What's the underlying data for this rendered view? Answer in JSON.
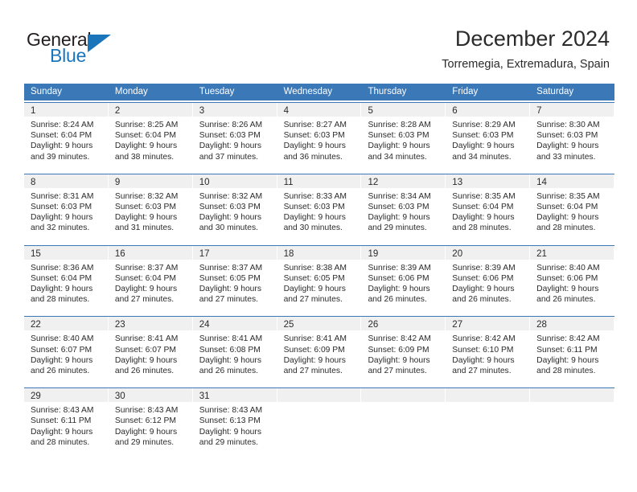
{
  "brand": {
    "general": "General",
    "blue": "Blue",
    "triangle_icon": "triangle-right-icon",
    "accent_color": "#1b75bb"
  },
  "header": {
    "title": "December 2024",
    "subtitle": "Torremegia, Extremadura, Spain"
  },
  "calendar": {
    "header_color": "#3b78b8",
    "daynum_band_color": "#f0f0f0",
    "weekdays": [
      "Sunday",
      "Monday",
      "Tuesday",
      "Wednesday",
      "Thursday",
      "Friday",
      "Saturday"
    ],
    "weeks": [
      [
        {
          "day": "1",
          "sunrise": "Sunrise: 8:24 AM",
          "sunset": "Sunset: 6:04 PM",
          "daylight1": "Daylight: 9 hours",
          "daylight2": "and 39 minutes."
        },
        {
          "day": "2",
          "sunrise": "Sunrise: 8:25 AM",
          "sunset": "Sunset: 6:04 PM",
          "daylight1": "Daylight: 9 hours",
          "daylight2": "and 38 minutes."
        },
        {
          "day": "3",
          "sunrise": "Sunrise: 8:26 AM",
          "sunset": "Sunset: 6:03 PM",
          "daylight1": "Daylight: 9 hours",
          "daylight2": "and 37 minutes."
        },
        {
          "day": "4",
          "sunrise": "Sunrise: 8:27 AM",
          "sunset": "Sunset: 6:03 PM",
          "daylight1": "Daylight: 9 hours",
          "daylight2": "and 36 minutes."
        },
        {
          "day": "5",
          "sunrise": "Sunrise: 8:28 AM",
          "sunset": "Sunset: 6:03 PM",
          "daylight1": "Daylight: 9 hours",
          "daylight2": "and 34 minutes."
        },
        {
          "day": "6",
          "sunrise": "Sunrise: 8:29 AM",
          "sunset": "Sunset: 6:03 PM",
          "daylight1": "Daylight: 9 hours",
          "daylight2": "and 34 minutes."
        },
        {
          "day": "7",
          "sunrise": "Sunrise: 8:30 AM",
          "sunset": "Sunset: 6:03 PM",
          "daylight1": "Daylight: 9 hours",
          "daylight2": "and 33 minutes."
        }
      ],
      [
        {
          "day": "8",
          "sunrise": "Sunrise: 8:31 AM",
          "sunset": "Sunset: 6:03 PM",
          "daylight1": "Daylight: 9 hours",
          "daylight2": "and 32 minutes."
        },
        {
          "day": "9",
          "sunrise": "Sunrise: 8:32 AM",
          "sunset": "Sunset: 6:03 PM",
          "daylight1": "Daylight: 9 hours",
          "daylight2": "and 31 minutes."
        },
        {
          "day": "10",
          "sunrise": "Sunrise: 8:32 AM",
          "sunset": "Sunset: 6:03 PM",
          "daylight1": "Daylight: 9 hours",
          "daylight2": "and 30 minutes."
        },
        {
          "day": "11",
          "sunrise": "Sunrise: 8:33 AM",
          "sunset": "Sunset: 6:03 PM",
          "daylight1": "Daylight: 9 hours",
          "daylight2": "and 30 minutes."
        },
        {
          "day": "12",
          "sunrise": "Sunrise: 8:34 AM",
          "sunset": "Sunset: 6:03 PM",
          "daylight1": "Daylight: 9 hours",
          "daylight2": "and 29 minutes."
        },
        {
          "day": "13",
          "sunrise": "Sunrise: 8:35 AM",
          "sunset": "Sunset: 6:04 PM",
          "daylight1": "Daylight: 9 hours",
          "daylight2": "and 28 minutes."
        },
        {
          "day": "14",
          "sunrise": "Sunrise: 8:35 AM",
          "sunset": "Sunset: 6:04 PM",
          "daylight1": "Daylight: 9 hours",
          "daylight2": "and 28 minutes."
        }
      ],
      [
        {
          "day": "15",
          "sunrise": "Sunrise: 8:36 AM",
          "sunset": "Sunset: 6:04 PM",
          "daylight1": "Daylight: 9 hours",
          "daylight2": "and 28 minutes."
        },
        {
          "day": "16",
          "sunrise": "Sunrise: 8:37 AM",
          "sunset": "Sunset: 6:04 PM",
          "daylight1": "Daylight: 9 hours",
          "daylight2": "and 27 minutes."
        },
        {
          "day": "17",
          "sunrise": "Sunrise: 8:37 AM",
          "sunset": "Sunset: 6:05 PM",
          "daylight1": "Daylight: 9 hours",
          "daylight2": "and 27 minutes."
        },
        {
          "day": "18",
          "sunrise": "Sunrise: 8:38 AM",
          "sunset": "Sunset: 6:05 PM",
          "daylight1": "Daylight: 9 hours",
          "daylight2": "and 27 minutes."
        },
        {
          "day": "19",
          "sunrise": "Sunrise: 8:39 AM",
          "sunset": "Sunset: 6:06 PM",
          "daylight1": "Daylight: 9 hours",
          "daylight2": "and 26 minutes."
        },
        {
          "day": "20",
          "sunrise": "Sunrise: 8:39 AM",
          "sunset": "Sunset: 6:06 PM",
          "daylight1": "Daylight: 9 hours",
          "daylight2": "and 26 minutes."
        },
        {
          "day": "21",
          "sunrise": "Sunrise: 8:40 AM",
          "sunset": "Sunset: 6:06 PM",
          "daylight1": "Daylight: 9 hours",
          "daylight2": "and 26 minutes."
        }
      ],
      [
        {
          "day": "22",
          "sunrise": "Sunrise: 8:40 AM",
          "sunset": "Sunset: 6:07 PM",
          "daylight1": "Daylight: 9 hours",
          "daylight2": "and 26 minutes."
        },
        {
          "day": "23",
          "sunrise": "Sunrise: 8:41 AM",
          "sunset": "Sunset: 6:07 PM",
          "daylight1": "Daylight: 9 hours",
          "daylight2": "and 26 minutes."
        },
        {
          "day": "24",
          "sunrise": "Sunrise: 8:41 AM",
          "sunset": "Sunset: 6:08 PM",
          "daylight1": "Daylight: 9 hours",
          "daylight2": "and 26 minutes."
        },
        {
          "day": "25",
          "sunrise": "Sunrise: 8:41 AM",
          "sunset": "Sunset: 6:09 PM",
          "daylight1": "Daylight: 9 hours",
          "daylight2": "and 27 minutes."
        },
        {
          "day": "26",
          "sunrise": "Sunrise: 8:42 AM",
          "sunset": "Sunset: 6:09 PM",
          "daylight1": "Daylight: 9 hours",
          "daylight2": "and 27 minutes."
        },
        {
          "day": "27",
          "sunrise": "Sunrise: 8:42 AM",
          "sunset": "Sunset: 6:10 PM",
          "daylight1": "Daylight: 9 hours",
          "daylight2": "and 27 minutes."
        },
        {
          "day": "28",
          "sunrise": "Sunrise: 8:42 AM",
          "sunset": "Sunset: 6:11 PM",
          "daylight1": "Daylight: 9 hours",
          "daylight2": "and 28 minutes."
        }
      ],
      [
        {
          "day": "29",
          "sunrise": "Sunrise: 8:43 AM",
          "sunset": "Sunset: 6:11 PM",
          "daylight1": "Daylight: 9 hours",
          "daylight2": "and 28 minutes."
        },
        {
          "day": "30",
          "sunrise": "Sunrise: 8:43 AM",
          "sunset": "Sunset: 6:12 PM",
          "daylight1": "Daylight: 9 hours",
          "daylight2": "and 29 minutes."
        },
        {
          "day": "31",
          "sunrise": "Sunrise: 8:43 AM",
          "sunset": "Sunset: 6:13 PM",
          "daylight1": "Daylight: 9 hours",
          "daylight2": "and 29 minutes."
        },
        {
          "day": "",
          "sunrise": "",
          "sunset": "",
          "daylight1": "",
          "daylight2": ""
        },
        {
          "day": "",
          "sunrise": "",
          "sunset": "",
          "daylight1": "",
          "daylight2": ""
        },
        {
          "day": "",
          "sunrise": "",
          "sunset": "",
          "daylight1": "",
          "daylight2": ""
        },
        {
          "day": "",
          "sunrise": "",
          "sunset": "",
          "daylight1": "",
          "daylight2": ""
        }
      ]
    ]
  }
}
